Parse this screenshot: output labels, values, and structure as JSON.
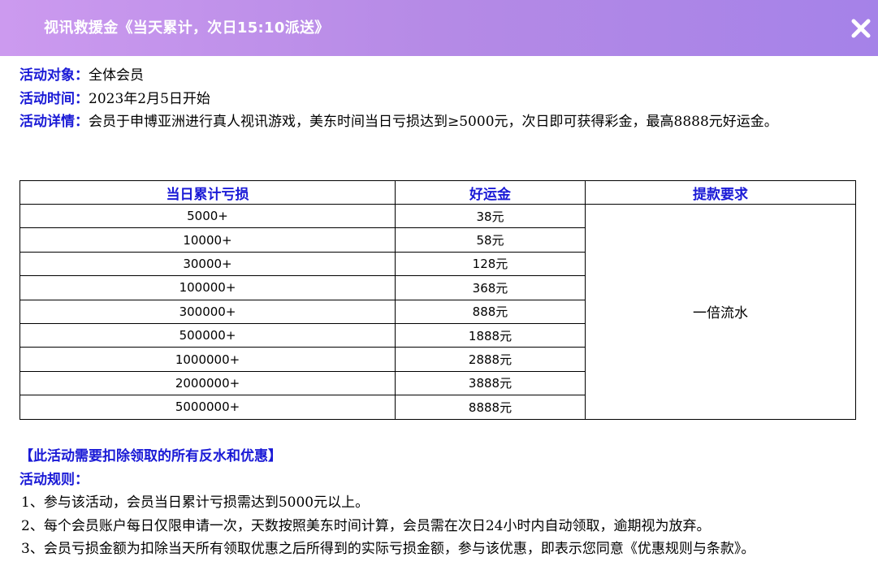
{
  "header": {
    "title": "视讯救援金《当天累计，次日15:10派送》",
    "close_icon": "close-icon"
  },
  "info": {
    "target_label": "活动对象：",
    "target_value": "全体会员",
    "time_label": "活动时间：",
    "time_value": "2023年2月5日开始",
    "details_label": "活动详情：",
    "details_value": "会员于申博亚洲进行真人视讯游戏，美东时间当日亏损达到≥5000元，次日即可获得彩金，最高8888元好运金。"
  },
  "table": {
    "headers": [
      "当日累计亏损",
      "好运金",
      "提款要求"
    ],
    "rows": [
      {
        "loss": "5000+",
        "bonus": "38元"
      },
      {
        "loss": "10000+",
        "bonus": "58元"
      },
      {
        "loss": "30000+",
        "bonus": "128元"
      },
      {
        "loss": "100000+",
        "bonus": "368元"
      },
      {
        "loss": "300000+",
        "bonus": "888元"
      },
      {
        "loss": "500000+",
        "bonus": "1888元"
      },
      {
        "loss": "1000000+",
        "bonus": "2888元"
      },
      {
        "loss": "2000000+",
        "bonus": "3888元"
      },
      {
        "loss": "5000000+",
        "bonus": "8888元"
      }
    ],
    "withdraw_requirement": "一倍流水"
  },
  "notice": {
    "deduct": "【此活动需要扣除领取的所有反水和优惠】",
    "rules_title": "活动规则：",
    "rules": [
      "1、参与该活动，会员当日累计亏损需达到5000元以上。",
      "2、每个会员账户每日仅限申请一次，天数按照美东时间计算，会员需在次日24小时内自动领取，逾期视为放弃。",
      "3、会员亏损金额为扣除当天所有领取优惠之后所得到的实际亏损金额，参与该优惠，即表示您同意《优惠规则与条款》。"
    ]
  },
  "colors": {
    "header_gradient_start": "#cc9aef",
    "header_gradient_end": "#a582e8",
    "accent_blue": "#1a1ad6"
  }
}
